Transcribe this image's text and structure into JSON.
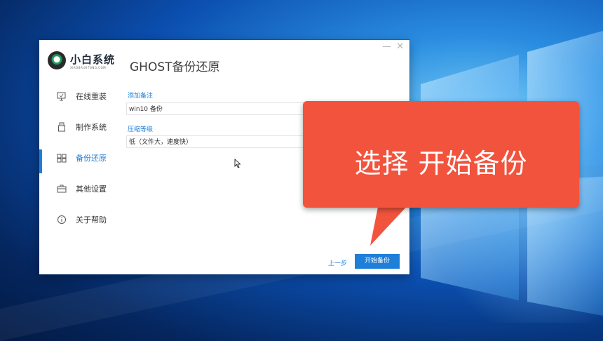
{
  "window": {
    "minimize_glyph": "—",
    "close_glyph": "✕"
  },
  "logo": {
    "name": "小白系统",
    "subtitle": "XIAOBAIXITONG.COM"
  },
  "page_title": "GHOST备份还原",
  "sidebar": {
    "items": [
      {
        "label": "在线重装",
        "icon": "monitor-icon",
        "active": false
      },
      {
        "label": "制作系统",
        "icon": "usb-icon",
        "active": false
      },
      {
        "label": "备份还原",
        "icon": "backup-icon",
        "active": true
      },
      {
        "label": "其他设置",
        "icon": "briefcase-icon",
        "active": false
      },
      {
        "label": "关于帮助",
        "icon": "info-icon",
        "active": false
      }
    ]
  },
  "form": {
    "remark_label": "添加备注",
    "remark_value": "win10 备份",
    "compression_label": "压缩等级",
    "compression_value": "低（文件大，速度快）"
  },
  "footer": {
    "prev_label": "上一步",
    "start_label": "开始备份"
  },
  "callout": {
    "text": "选择 开始备份"
  },
  "colors": {
    "accent": "#1e7fd8",
    "callout": "#f2533d"
  }
}
